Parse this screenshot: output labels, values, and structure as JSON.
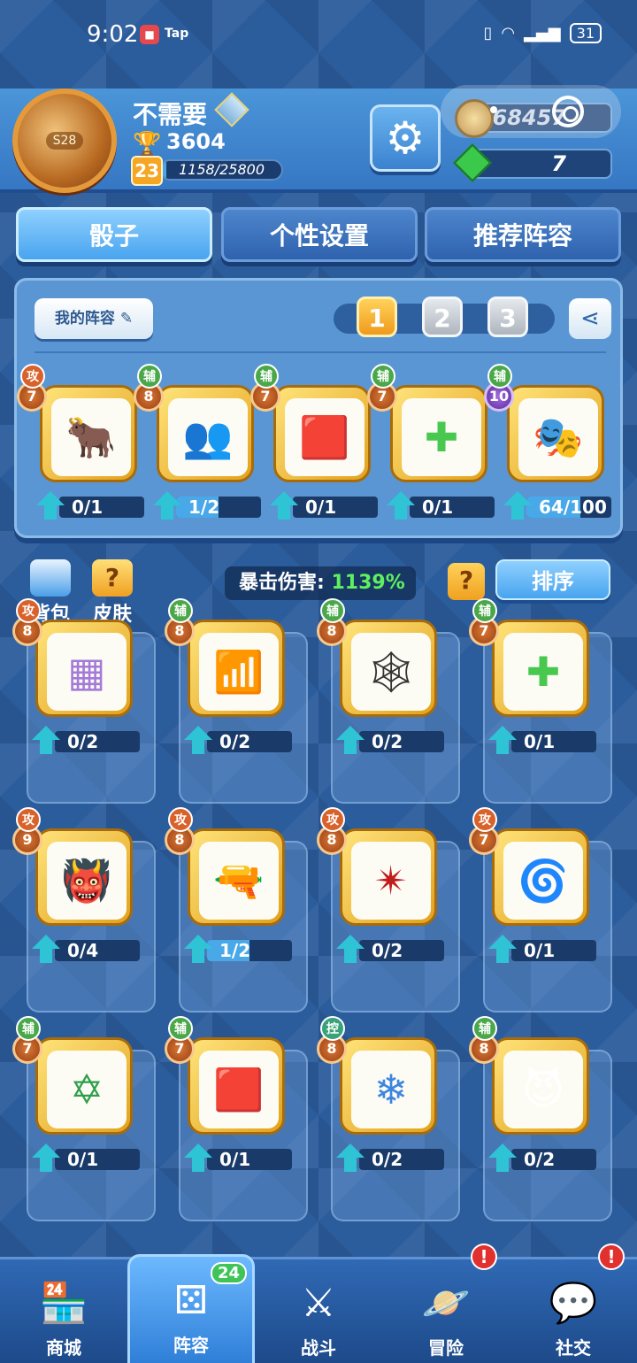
{
  "status_bar": {
    "time": "9:02",
    "app_badge": "Tap",
    "battery": "31"
  },
  "player": {
    "name": "不需要",
    "avatar_label": "S28",
    "trophies": "3604",
    "level": "23",
    "xp": "1158/25800",
    "xp_fraction": 0.045
  },
  "currency": {
    "coins": "68457",
    "gems": "7"
  },
  "tabs": [
    {
      "label": "骰子"
    },
    {
      "label": "个性设置"
    },
    {
      "label": "推荐阵容"
    }
  ],
  "deck": {
    "title": "我的阵容",
    "slots": [
      "1",
      "2",
      "3"
    ],
    "dice": [
      {
        "icon": "bull-icon",
        "level": "7",
        "type": "攻",
        "progress": "0/1",
        "fill": 0
      },
      {
        "icon": "shadow-figure-icon",
        "level": "8",
        "type": "辅",
        "progress": "1/2",
        "fill": 0.5
      },
      {
        "icon": "red-cylinder-icon",
        "level": "7",
        "type": "辅",
        "progress": "0/1",
        "fill": 0
      },
      {
        "icon": "green-cross-icon",
        "level": "7",
        "type": "辅",
        "progress": "0/1",
        "fill": 0
      },
      {
        "icon": "mask-icon",
        "level": "10",
        "type": "辅",
        "progress": "64/100",
        "fill": 0.64
      }
    ]
  },
  "collection": {
    "bag_label": "背包",
    "skin_label": "皮肤",
    "crit_label": "暴击伤害:",
    "crit_value": "1139%",
    "help_label": "?",
    "sort_label": "排序",
    "dice": [
      {
        "icon": "purple-grid-icon",
        "level": "8",
        "type": "攻",
        "progress": "0/2",
        "fill": 0
      },
      {
        "icon": "signal-icon",
        "level": "8",
        "type": "辅",
        "progress": "0/2",
        "fill": 0
      },
      {
        "icon": "web-icon",
        "level": "8",
        "type": "辅",
        "progress": "0/2",
        "fill": 0
      },
      {
        "icon": "green-cross-icon",
        "level": "7",
        "type": "辅",
        "progress": "0/1",
        "fill": 0
      },
      {
        "icon": "hair-face-icon",
        "level": "9",
        "type": "攻",
        "progress": "0/4",
        "fill": 0
      },
      {
        "icon": "revolver-icon",
        "level": "8",
        "type": "攻",
        "progress": "1/2",
        "fill": 0.5
      },
      {
        "icon": "blood-shuriken-icon",
        "level": "8",
        "type": "攻",
        "progress": "0/2",
        "fill": 0
      },
      {
        "icon": "sun-spiral-icon",
        "level": "7",
        "type": "攻",
        "progress": "0/1",
        "fill": 0
      },
      {
        "icon": "magic-circle-icon",
        "level": "7",
        "type": "辅",
        "progress": "0/1",
        "fill": 0
      },
      {
        "icon": "red-cylinder-icon",
        "level": "7",
        "type": "辅",
        "progress": "0/1",
        "fill": 0
      },
      {
        "icon": "snowflake-icon",
        "level": "8",
        "type": "控",
        "progress": "0/2",
        "fill": 0
      },
      {
        "icon": "purple-demon-icon",
        "level": "8",
        "type": "辅",
        "progress": "0/2",
        "fill": 0
      }
    ]
  },
  "nav": [
    {
      "label": "商城",
      "icon": "shop-icon"
    },
    {
      "label": "阵容",
      "icon": "dice-icon",
      "badge": "24"
    },
    {
      "label": "战斗",
      "icon": "crossed-swords-icon"
    },
    {
      "label": "冒险",
      "icon": "planet-icon",
      "alert": "!"
    },
    {
      "label": "社交",
      "icon": "chat-bubbles-icon",
      "alert": "!"
    }
  ],
  "colors": {
    "attack": "#d9622b",
    "support": "#4aa84a",
    "control": "#3aa27a",
    "crit_value": "#5ef05e"
  }
}
